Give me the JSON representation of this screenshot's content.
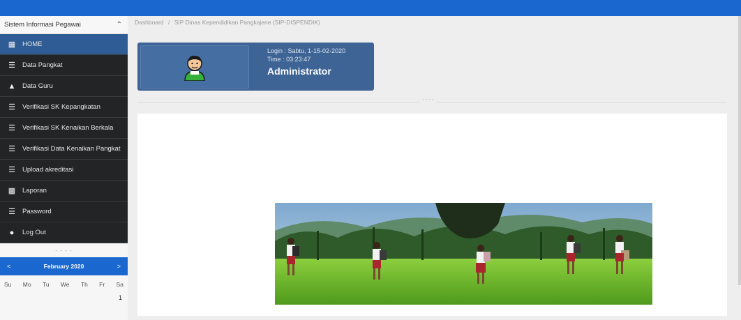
{
  "app": {
    "title": "Sistem Informasi Pegawai"
  },
  "breadcrumb": {
    "home": "Dashboard",
    "current": "SIP Dinas Kependidikan Pangkajene (SIP-DISPENDIK)"
  },
  "sidebar": {
    "items": [
      {
        "label": "HOME",
        "icon": "grid-icon",
        "active": true
      },
      {
        "label": "Data Pangkat",
        "icon": "list-icon"
      },
      {
        "label": "Data Guru",
        "icon": "user-icon"
      },
      {
        "label": "Verifikasi SK Kepangkatan",
        "icon": "list-icon"
      },
      {
        "label": "Verifikasi SK Kenaikan Berkala",
        "icon": "list-icon"
      },
      {
        "label": "Verifikasi Data Kenaikan Pangkat",
        "icon": "list-icon"
      },
      {
        "label": "Upload akreditasi",
        "icon": "list-icon"
      },
      {
        "label": "Laporan",
        "icon": "print-icon"
      },
      {
        "label": "Password",
        "icon": "list-icon"
      },
      {
        "label": "Log Out",
        "icon": "power-icon"
      }
    ]
  },
  "calendar": {
    "heading": "- - - -",
    "prev": "<",
    "next": ">",
    "month": "February 2020",
    "days": [
      "Su",
      "Mo",
      "Tu",
      "We",
      "Th",
      "Fr",
      "Sa"
    ],
    "first_day": "1"
  },
  "login_card": {
    "login_line": "Login : Sabtu, 1-15-02-2020",
    "time_line": "Time : 03:23:47",
    "role": "Administrator"
  },
  "divider_label": "- - - -",
  "colors": {
    "topbar": "#1a67cf",
    "sidebar_dark": "#222426",
    "active": "#2f5c94",
    "card": "#3d6495"
  }
}
